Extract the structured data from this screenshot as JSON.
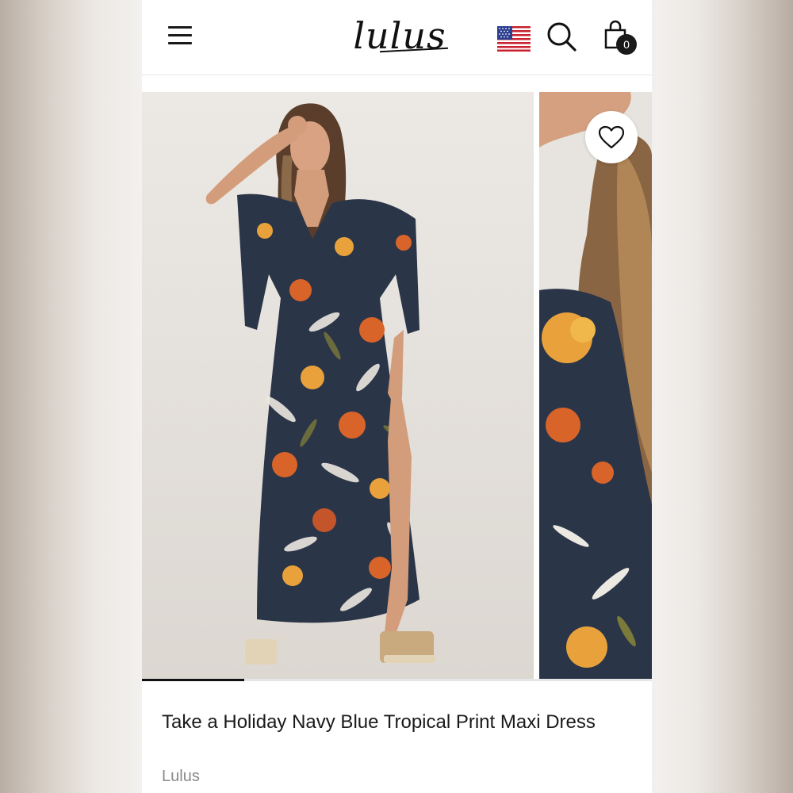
{
  "header": {
    "logo_text": "lulus",
    "menu_icon": "hamburger-menu-icon",
    "flag_icon": "us-flag-icon",
    "search_icon": "search-icon",
    "bag_icon": "shopping-bag-icon",
    "cart_count": "0"
  },
  "gallery": {
    "images": [
      "model-full-length-photo",
      "model-dress-detail-photo"
    ],
    "favorite_icon": "heart-outline-icon",
    "current_index": 1,
    "total_images": 5,
    "progress_fraction": 0.2
  },
  "product": {
    "title": "Take a Holiday Navy Blue Tropical Print Maxi Dress",
    "brand": "Lulus"
  },
  "colors": {
    "text": "#1a1a1a",
    "muted": "#8a8a8a",
    "dress_navy": "#2b3548",
    "print_orange": "#d8642a",
    "print_gold": "#e9a23b"
  }
}
